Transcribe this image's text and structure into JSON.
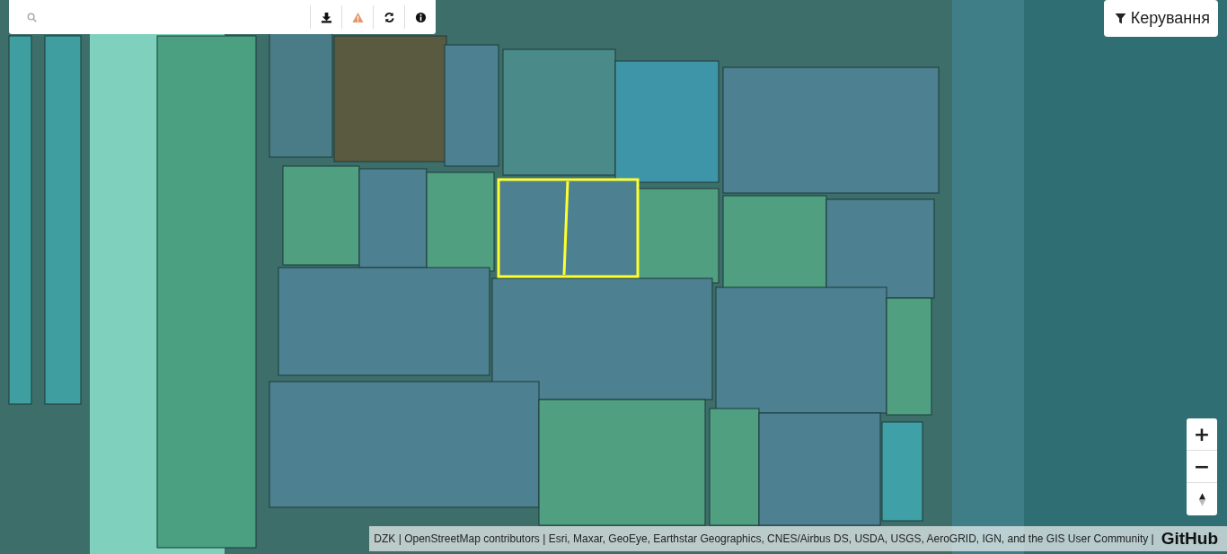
{
  "toolbar": {
    "buttons": [
      {
        "kind": "download"
      },
      {
        "kind": "warning"
      },
      {
        "kind": "refresh"
      },
      {
        "kind": "info"
      }
    ]
  },
  "controls_button": {
    "label": "Керування"
  },
  "zoom": {
    "buttons": [
      "+",
      "−"
    ]
  },
  "attribution": {
    "text": "DZK | OpenStreetMap contributors | Esri, Maxar, GeoEye, Earthstar Geographics, CNES/Airbus DS, USDA, USGS, AeroGRID, IGN, and the GIS User Community |",
    "link": "GitHub"
  }
}
